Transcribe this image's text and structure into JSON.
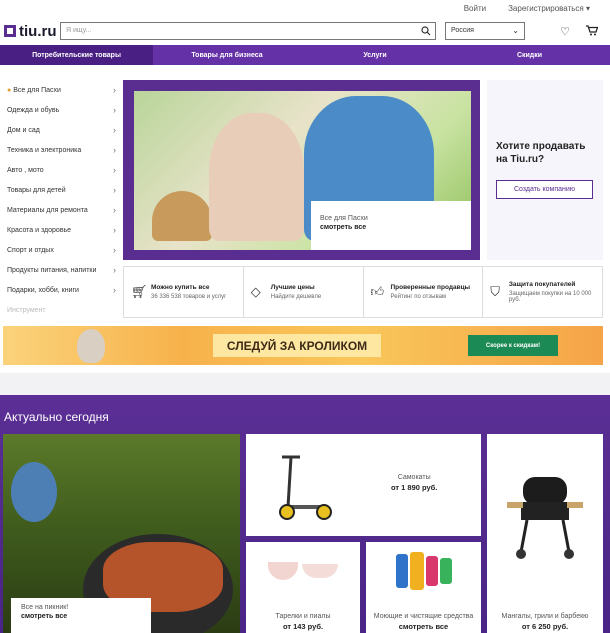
{
  "top": {
    "login": "Войти",
    "register": "Зарегистрироваться"
  },
  "header": {
    "logo": "tiu.ru",
    "search_placeholder": "Я ищу...",
    "region": "Россия"
  },
  "nav": [
    "Потребительские товары",
    "Товары для бизнеса",
    "Услуги",
    "Скидки"
  ],
  "categories": [
    "Все для Пасхи",
    "Одежда и обувь",
    "Дом и сад",
    "Техника и электроника",
    "Авто , мото",
    "Товары для детей",
    "Материалы для ремонта",
    "Красота и здоровье",
    "Спорт и отдых",
    "Продукты питания, напитки",
    "Подарки, хобби, книги",
    "Инструмент"
  ],
  "banner": {
    "label": "Все для Пасхи",
    "link": "смотреть все"
  },
  "sell": {
    "title": "Хотите продавать на Tiu.ru?",
    "button": "Создать компанию"
  },
  "features": [
    {
      "icon": "cart-icon",
      "title": "Можно купить все",
      "desc": "36 336 538 товаров и услуг"
    },
    {
      "icon": "tag-icon",
      "title": "Лучшие цены",
      "desc": "Найдите дешевле"
    },
    {
      "icon": "thumbs-up-icon",
      "title": "Проверенные продавцы",
      "desc": "Рейтинг по отзывам"
    },
    {
      "icon": "shield-icon",
      "title": "Защита покупателей",
      "desc": "Защищаем покупки на 10 000 руб."
    }
  ],
  "promo": {
    "slogan": "СЛЕДУЙ ЗА КРОЛИКОМ",
    "button": "Скорее к скидкам!"
  },
  "today": {
    "title": "Актуально сегодня",
    "picnic": {
      "label": "Все на пикник!",
      "link": "смотреть все"
    },
    "scooters": {
      "label": "Самокаты",
      "price": "от 1 890 руб."
    },
    "plates": {
      "label": "Тарелки и пиалы",
      "price": "от 143 руб."
    },
    "cleaners": {
      "label": "Моющие и чистящие средства",
      "link": "смотреть все"
    },
    "bbq": {
      "label": "Мангалы, грили и барбекю",
      "price": "от 6 250 руб."
    }
  },
  "colors": {
    "brand": "#6431a6",
    "brand_dark": "#4a1f84",
    "promo_green": "#1b8a55"
  }
}
